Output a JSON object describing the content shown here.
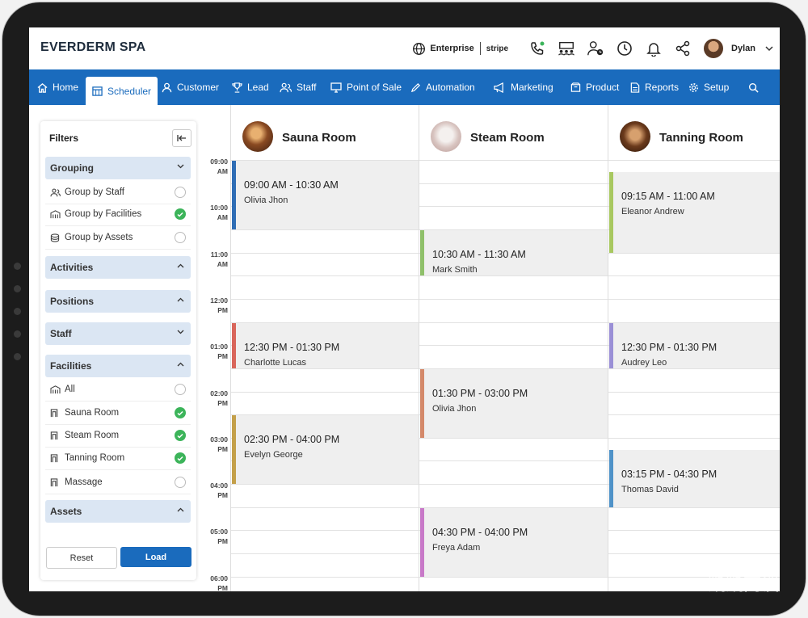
{
  "app": {
    "brand": "EVERDERM SPA"
  },
  "topbar": {
    "plan": "Enterprise",
    "payment": "stripe",
    "user": "Dylan"
  },
  "nav": {
    "items": [
      {
        "label": "Home",
        "icon": "home-icon"
      },
      {
        "label": "Scheduler",
        "icon": "calendar-icon",
        "active": true
      },
      {
        "label": "Customer",
        "icon": "user-icon"
      },
      {
        "label": "Lead",
        "icon": "trophy-icon"
      },
      {
        "label": "Staff",
        "icon": "staff-icon"
      },
      {
        "label": "Point of Sale",
        "icon": "monitor-icon"
      },
      {
        "label": "Automation",
        "icon": "pencil-icon"
      },
      {
        "label": "Marketing",
        "icon": "megaphone-icon"
      },
      {
        "label": "Product",
        "icon": "box-icon"
      },
      {
        "label": "Reports",
        "icon": "document-icon"
      },
      {
        "label": "Setup",
        "icon": "gear-icon"
      }
    ]
  },
  "filters": {
    "title": "Filters",
    "grouping": {
      "label": "Grouping",
      "options": [
        {
          "label": "Group by Staff",
          "checked": false
        },
        {
          "label": "Group by Facilities",
          "checked": true
        },
        {
          "label": "Group by Assets",
          "checked": false
        }
      ]
    },
    "activities": "Activities",
    "positions": "Positions",
    "staff": "Staff",
    "facilities": {
      "label": "Facilities",
      "options": [
        {
          "label": "All",
          "checked": false
        },
        {
          "label": "Sauna Room",
          "checked": true
        },
        {
          "label": "Steam Room",
          "checked": true
        },
        {
          "label": "Tanning Room",
          "checked": true
        },
        {
          "label": "Massage",
          "checked": false
        }
      ]
    },
    "assets": "Assets",
    "reset": "Reset",
    "load": "Load"
  },
  "scheduler": {
    "times": [
      [
        "09:00",
        "AM"
      ],
      [
        "10:00",
        "AM"
      ],
      [
        "11:00",
        "AM"
      ],
      [
        "12:00",
        "PM"
      ],
      [
        "01:00",
        "PM"
      ],
      [
        "02:00",
        "PM"
      ],
      [
        "03:00",
        "PM"
      ],
      [
        "04:00",
        "PM"
      ],
      [
        "05:00",
        "PM"
      ],
      [
        "06:00",
        "PM"
      ]
    ],
    "rooms": [
      {
        "name": "Sauna Room",
        "appointments": [
          {
            "time": "09:00 AM - 10:30 AM",
            "client": "Olivia Jhon",
            "color": "#2f6db5"
          },
          {
            "time": "12:30 PM - 01:30 PM",
            "client": "Charlotte Lucas",
            "color": "#d9665b"
          },
          {
            "time": "02:30 PM - 04:00 PM",
            "client": "Evelyn George",
            "color": "#c4a04a"
          }
        ]
      },
      {
        "name": "Steam Room",
        "appointments": [
          {
            "time": "10:30 AM - 11:30 AM",
            "client": "Mark Smith",
            "color": "#8fc06a"
          },
          {
            "time": "01:30 PM - 03:00 PM",
            "client": "Olivia Jhon",
            "color": "#d4896a"
          },
          {
            "time": "04:30 PM - 04:00 PM",
            "client": "Freya Adam",
            "color": "#c879c8"
          }
        ]
      },
      {
        "name": "Tanning Room",
        "appointments": [
          {
            "time": "09:15 AM - 11:00 AM",
            "client": "Eleanor Andrew",
            "color": "#a8c860"
          },
          {
            "time": "12:30 PM - 01:30 PM",
            "client": "Audrey Leo",
            "color": "#9a8fd6"
          },
          {
            "time": "03:15 PM - 04:30 PM",
            "client": "Thomas David",
            "color": "#4f92c8"
          }
        ]
      }
    ]
  },
  "watermark": "凯凯而谈"
}
